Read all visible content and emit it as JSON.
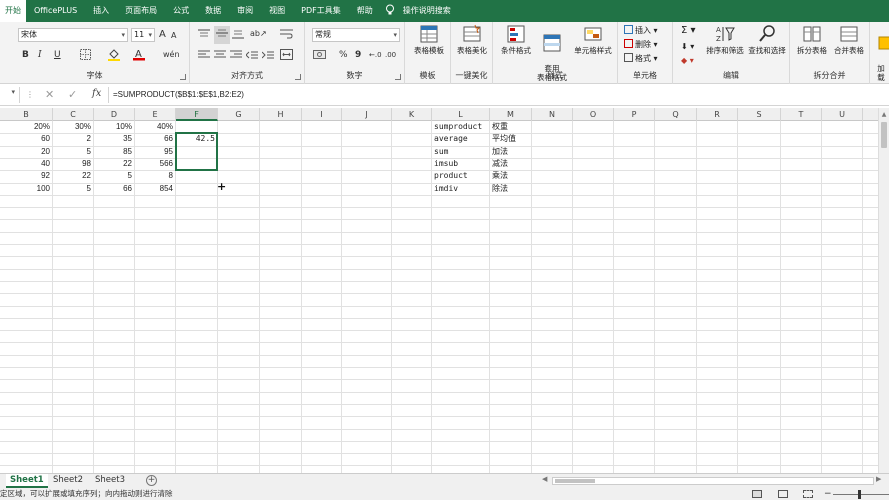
{
  "menu_tabs": [
    "开始",
    "OfficePLUS",
    "插入",
    "页面布局",
    "公式",
    "数据",
    "审阅",
    "视图",
    "PDF工具集",
    "帮助",
    "操作说明搜索"
  ],
  "ribbon": {
    "font_name": "宋体",
    "font_size": "11",
    "bold": "B",
    "italic": "I",
    "underline": "U",
    "font_grow": "A",
    "font_shrink": "A",
    "number_format": "常规",
    "percent": "%",
    "comma": "9",
    "groups": [
      "字体",
      "对齐方式",
      "数字",
      "模板",
      "一键美化",
      "样式",
      "单元格",
      "编辑",
      "拆分合并"
    ],
    "buttons": {
      "table_template": "表格模板",
      "table_beautify": "表格美化",
      "conditional_format": "条件格式",
      "apply_table_format": "套用\n表格格式",
      "cell_style": "单元格样式",
      "insert": "插入",
      "delete": "删除",
      "format": "格式",
      "sort_filter": "排序和筛选",
      "find_select": "查找和选择",
      "split_table": "拆分表格",
      "merge_table": "合并表格",
      "add": "加\n载"
    },
    "accent_color": "#217346"
  },
  "formula_bar": {
    "formula": "=SUMPRODUCT($B$1:$E$1,B2:E2)",
    "icons": [
      "cancel-icon",
      "enter-icon",
      "fx-icon"
    ]
  },
  "columns": [
    "B",
    "C",
    "D",
    "E",
    "F",
    "G",
    "H",
    "I",
    "J",
    "K",
    "L",
    "M",
    "N",
    "O",
    "P",
    "Q",
    "R",
    "S",
    "T",
    "U"
  ],
  "selected_column": "F",
  "cells": {
    "B": [
      "20%",
      "60",
      "20",
      "40",
      "92",
      "100"
    ],
    "C": [
      "30%",
      "2",
      "5",
      "98",
      "22",
      "5"
    ],
    "D": [
      "10%",
      "35",
      "85",
      "22",
      "5",
      "66"
    ],
    "E": [
      "40%",
      "66",
      "95",
      "566",
      "8",
      "854"
    ],
    "F2": "42.5",
    "L": [
      "sumproduct",
      "average",
      "sum",
      "imsub",
      "product",
      "imdiv"
    ],
    "M": [
      "权重",
      "平均值",
      "加法",
      "减法",
      "乘法",
      "除法"
    ]
  },
  "sheets": [
    "Sheet1",
    "Sheet2",
    "Sheet3"
  ],
  "active_sheet": "Sheet1",
  "status_text": "定区域，可以扩展或填充序列；向内拖动则进行清除"
}
